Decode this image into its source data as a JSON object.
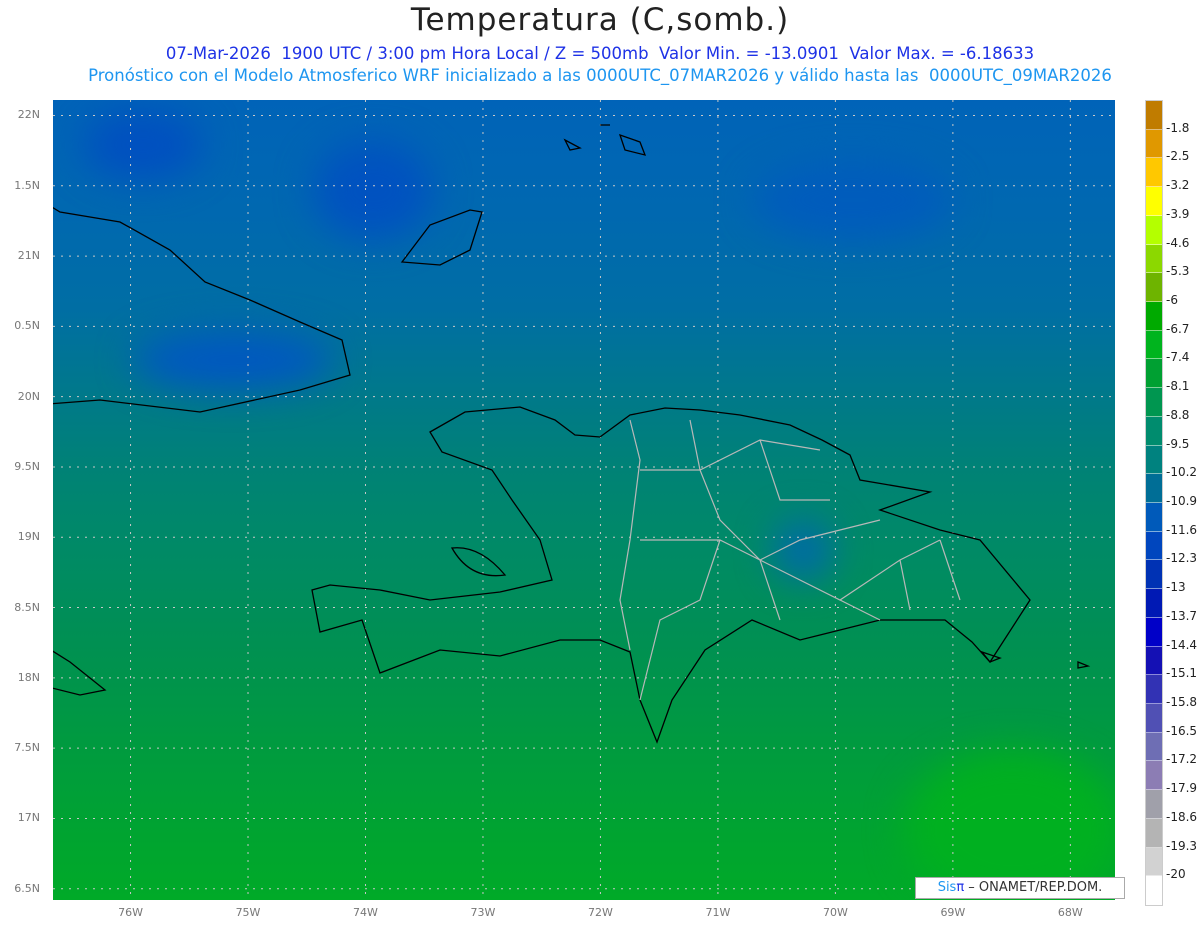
{
  "header": {
    "title": "Temperatura (C,somb.)",
    "line1": "07-Mar-2026  1900 UTC / 3:00 pm Hora Local / Z = 500mb  Valor Min. = -13.0901  Valor Max. = -6.18633",
    "line2": "Pronóstico con el Modelo Atmosferico WRF inicializado a las 0000UTC_07MAR2026 y válido hasta las  0000UTC_09MAR2026"
  },
  "map": {
    "lat_range": [
      16.42,
      22.11
    ],
    "lon_range": [
      -76.66,
      -67.62
    ],
    "lat_ticks": [
      {
        "value": 22,
        "label": "22N"
      },
      {
        "value": 21.5,
        "label": "1.5N"
      },
      {
        "value": 21,
        "label": "21N"
      },
      {
        "value": 20.5,
        "label": "0.5N"
      },
      {
        "value": 20,
        "label": "20N"
      },
      {
        "value": 19.5,
        "label": "9.5N"
      },
      {
        "value": 19,
        "label": "19N"
      },
      {
        "value": 18.5,
        "label": "8.5N"
      },
      {
        "value": 18,
        "label": "18N"
      },
      {
        "value": 17.5,
        "label": "7.5N"
      },
      {
        "value": 17,
        "label": "17N"
      },
      {
        "value": 16.5,
        "label": "6.5N"
      }
    ],
    "lon_ticks": [
      {
        "value": -76,
        "label": "76W"
      },
      {
        "value": -75,
        "label": "75W"
      },
      {
        "value": -74,
        "label": "74W"
      },
      {
        "value": -73,
        "label": "73W"
      },
      {
        "value": -72,
        "label": "72W"
      },
      {
        "value": -71,
        "label": "71W"
      },
      {
        "value": -70,
        "label": "70W"
      },
      {
        "value": -69,
        "label": "69W"
      },
      {
        "value": -68,
        "label": "68W"
      }
    ],
    "grid": true
  },
  "colorbar": {
    "labels": [
      "-1.8",
      "-2.5",
      "-3.2",
      "-3.9",
      "-4.6",
      "-5.3",
      "-6",
      "-6.7",
      "-7.4",
      "-8.1",
      "-8.8",
      "-9.5",
      "-10.2",
      "-10.9",
      "-11.6",
      "-12.3",
      "-13",
      "-13.7",
      "-14.4",
      "-15.1",
      "-15.8",
      "-16.5",
      "-17.2",
      "-17.9",
      "-18.6",
      "-19.3",
      "-20"
    ],
    "colors": [
      "#c07c00",
      "#e09800",
      "#ffc800",
      "#ffff00",
      "#b4ff00",
      "#8cd800",
      "#6eb400",
      "#00aa00",
      "#00b41e",
      "#00a032",
      "#009650",
      "#008c6e",
      "#00827f",
      "#006e96",
      "#005aba",
      "#0046be",
      "#0032b4",
      "#0019b4",
      "#0000c8",
      "#1410b4",
      "#3232b4",
      "#5050b4",
      "#6e6eb4",
      "#8c7db4",
      "#a0a0aa",
      "#b4b4b4",
      "#d2d2d2",
      "#ffffff"
    ]
  },
  "credit": {
    "sis": "Sis",
    "pi": "π",
    "text": " –  ONAMET/REP.DOM."
  }
}
